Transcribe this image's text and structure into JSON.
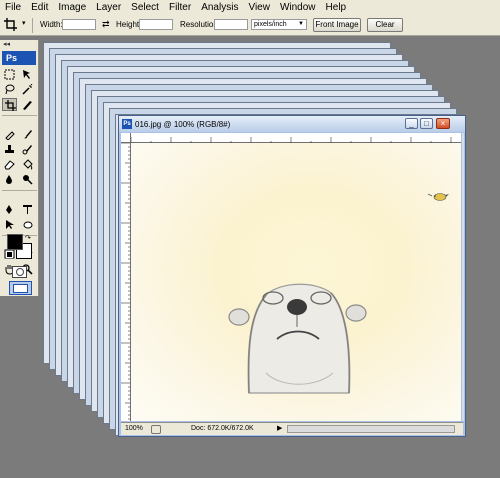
{
  "menubar": {
    "items": [
      "File",
      "Edit",
      "Image",
      "Layer",
      "Select",
      "Filter",
      "Analysis",
      "View",
      "Window",
      "Help"
    ]
  },
  "options_bar": {
    "width_label": "Width:",
    "width_value": "",
    "height_label": "Height:",
    "height_value": "",
    "resolution_label": "Resolution:",
    "resolution_value": "",
    "units_selected": "pixels/inch",
    "front_image_button": "Front Image",
    "clear_button": "Clear"
  },
  "toolbox": {
    "collapse_glyph": "◂◂",
    "app_badge": "Ps",
    "tools": [
      "marquee-icon",
      "move-icon",
      "lasso-icon",
      "magic-wand-icon",
      "crop-icon",
      "slice-icon",
      "healing-brush-icon",
      "brush-icon",
      "clone-stamp-icon",
      "history-brush-icon",
      "eraser-icon",
      "paint-bucket-icon",
      "blur-icon",
      "dodge-icon",
      "pen-icon",
      "type-icon",
      "path-selection-icon",
      "shape-icon",
      "notes-icon",
      "eyedropper-icon",
      "hand-icon",
      "zoom-icon"
    ],
    "active_tool": "crop-icon",
    "foreground_color": "#000000",
    "background_color": "#ffffff"
  },
  "document": {
    "title": "016.jpg @ 100% (RGB/8#)",
    "app_icon_label": "Ps",
    "zoom": "100%",
    "doc_size": "Doc: 672.0K/672.0K",
    "status_arrow": "▶"
  },
  "colors": {
    "workspace": "#7b7b7b",
    "chrome": "#ece9d8",
    "accent": "#1d53b3",
    "window_frame": "#aac2e5"
  }
}
